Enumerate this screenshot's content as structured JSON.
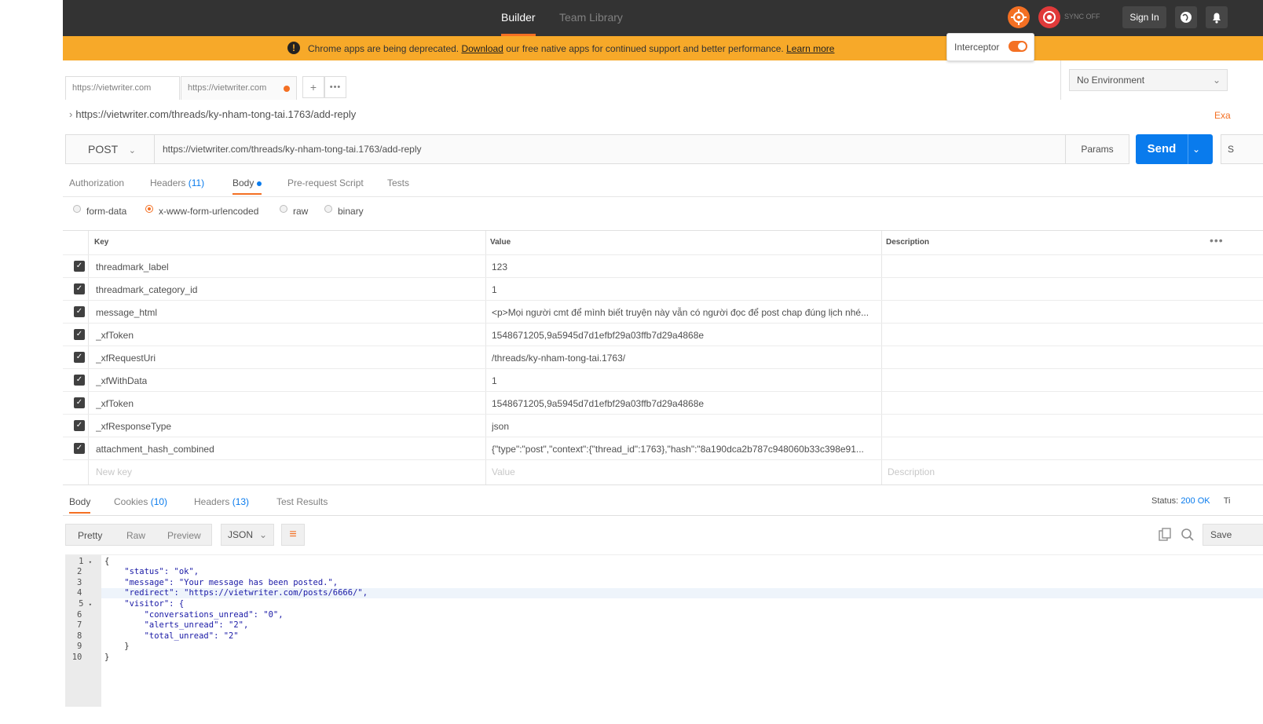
{
  "topbar": {
    "tabs": [
      "Builder",
      "Team Library"
    ],
    "sync_label": "SYNC OFF",
    "sign_in": "Sign In"
  },
  "banner": {
    "text_before": "Chrome apps are being deprecated.",
    "download_link": "Download",
    "text_middle": "our free native apps for continued support and better performance.",
    "learn_more": "Learn more"
  },
  "interceptor": {
    "label": "Interceptor",
    "enabled": true
  },
  "request_tabs": [
    {
      "label": "https://vietwriter.com"
    },
    {
      "label": "https://vietwriter.com"
    }
  ],
  "environment": {
    "selected": "No Environment"
  },
  "breadcrumb": "https://vietwriter.com/threads/ky-nham-tong-tai.1763/add-reply",
  "examples_link": "Exa",
  "request": {
    "method": "POST",
    "url": "https://vietwriter.com/threads/ky-nham-tong-tai.1763/add-reply",
    "params_label": "Params",
    "send_label": "Send",
    "save_label": "S"
  },
  "subtabs": {
    "authorization": "Authorization",
    "headers": "Headers",
    "headers_count": "(11)",
    "body": "Body",
    "prerequest": "Pre-request Script",
    "tests": "Tests"
  },
  "body_modes": [
    "form-data",
    "x-www-form-urlencoded",
    "raw",
    "binary"
  ],
  "body_mode_selected": "x-www-form-urlencoded",
  "table": {
    "headers": {
      "key": "Key",
      "value": "Value",
      "description": "Description"
    },
    "rows": [
      {
        "key": "threadmark_label",
        "value": "123"
      },
      {
        "key": "threadmark_category_id",
        "value": "1"
      },
      {
        "key": "message_html",
        "value": "<p>Mọi người cmt để mình biết truyện này vẫn có người đọc để post chap đúng lịch nhé..."
      },
      {
        "key": "_xfToken",
        "value": "1548671205,9a5945d7d1efbf29a03ffb7d29a4868e"
      },
      {
        "key": "_xfRequestUri",
        "value": "/threads/ky-nham-tong-tai.1763/"
      },
      {
        "key": "_xfWithData",
        "value": "1"
      },
      {
        "key": "_xfToken",
        "value": "1548671205,9a5945d7d1efbf29a03ffb7d29a4868e"
      },
      {
        "key": "_xfResponseType",
        "value": "json"
      },
      {
        "key": "attachment_hash_combined",
        "value": "{\"type\":\"post\",\"context\":{\"thread_id\":1763},\"hash\":\"8a190dca2b787c948060b33c398e91..."
      }
    ],
    "new_row": {
      "key": "New key",
      "value": "Value",
      "description": "Description"
    }
  },
  "response": {
    "tabs": {
      "body": "Body",
      "cookies": "Cookies",
      "cookies_count": "(10)",
      "headers": "Headers",
      "headers_count": "(13)",
      "test_results": "Test Results"
    },
    "status_label": "Status:",
    "status_value": "200 OK",
    "time_label": "Ti",
    "formats": [
      "Pretty",
      "Raw",
      "Preview"
    ],
    "language": "JSON",
    "save_label": "Save",
    "code_lines": [
      "{",
      "    \"status\": \"ok\",",
      "    \"message\": \"Your message has been posted.\",",
      "    \"redirect\": \"https://vietwriter.com/posts/6666/\",",
      "    \"visitor\": {",
      "        \"conversations_unread\": \"0\",",
      "        \"alerts_unread\": \"2\",",
      "        \"total_unread\": \"2\"",
      "    }",
      "}"
    ]
  }
}
